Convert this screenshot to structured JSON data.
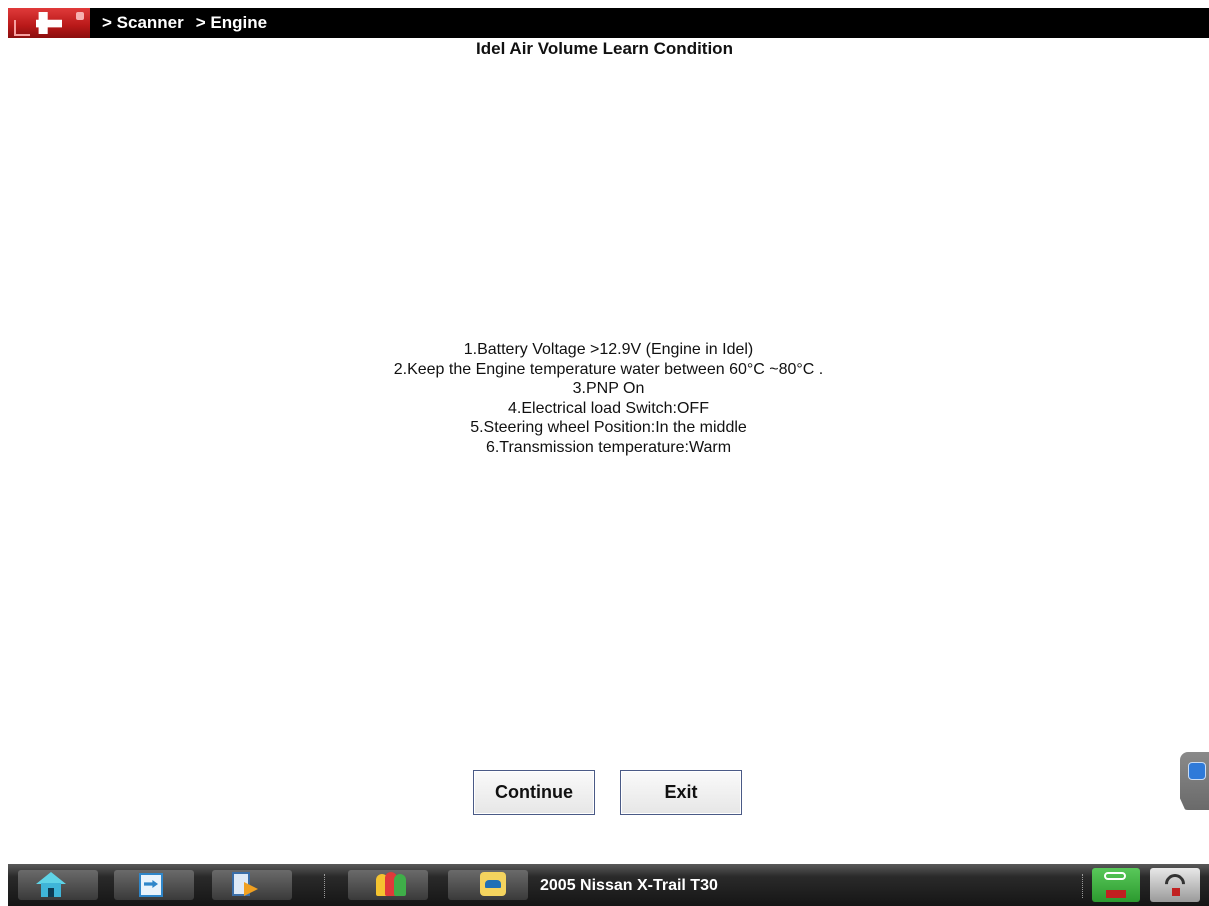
{
  "header": {
    "breadcrumbs": [
      "> Scanner",
      "> Engine"
    ]
  },
  "page": {
    "title": "Idel Air Volume Learn Condition",
    "conditions": [
      "1.Battery Voltage >12.9V (Engine in Idel)",
      "2.Keep the Engine temperature water between 60°C ~80°C .",
      "3.PNP On",
      "4.Electrical load Switch:OFF",
      "5.Steering wheel Position:In the middle",
      "6.Transmission temperature:Warm"
    ]
  },
  "buttons": {
    "continue_label": "Continue",
    "exit_label": "Exit"
  },
  "taskbar": {
    "vehicle": "2005 Nissan X-Trail T30",
    "icons": [
      "home-icon",
      "list-icon",
      "tools-icon",
      "people-icon",
      "car-icon",
      "usb-icon",
      "signal-icon"
    ]
  },
  "colors": {
    "header_bg": "#000000",
    "logo_red": "#c81e1e",
    "button_border": "#4a5a86",
    "taskbar_bg": "#1a1a1a"
  }
}
